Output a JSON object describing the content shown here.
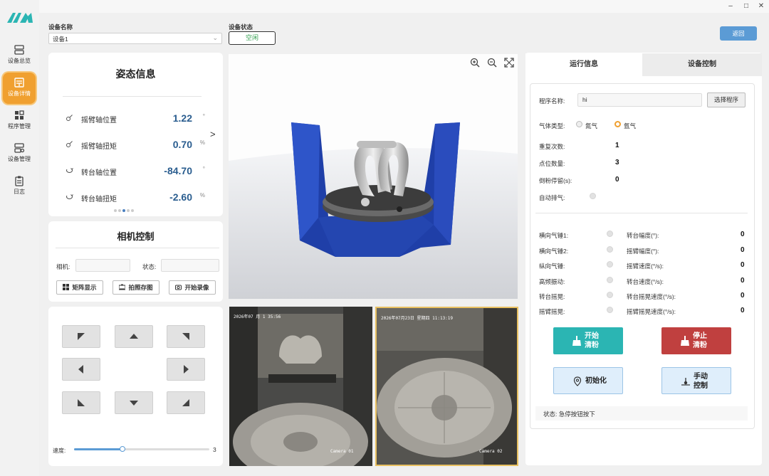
{
  "window": {
    "minimize": "–",
    "maximize": "□",
    "close": "✕"
  },
  "sidebar": {
    "items": [
      {
        "label": "设备总览",
        "icon": "server-icon"
      },
      {
        "label": "设备详情",
        "icon": "detail-icon",
        "active": true
      },
      {
        "label": "程序管理",
        "icon": "grid-icon"
      },
      {
        "label": "设备管理",
        "icon": "device-icon"
      },
      {
        "label": "日志",
        "icon": "clipboard-icon"
      }
    ]
  },
  "header": {
    "device_name_label": "设备名称",
    "device_name_value": "设备1",
    "device_status_label": "设备状态",
    "device_status_value": "空闲",
    "back_label": "返回"
  },
  "pose": {
    "title": "姿态信息",
    "rows": [
      {
        "name": "摇臂轴位置",
        "value": "1.22",
        "unit": "°"
      },
      {
        "name": "摇臂轴扭矩",
        "value": "0.70",
        "unit": "%"
      },
      {
        "name": "转台轴位置",
        "value": "-84.70",
        "unit": "°"
      },
      {
        "name": "转台轴扭矩",
        "value": "-2.60",
        "unit": "%"
      }
    ],
    "next": ">",
    "page_count": 5,
    "page_active": 2
  },
  "camera": {
    "title": "相机控制",
    "camera_label": "相机:",
    "status_label": "状态:",
    "matrix_btn": "矩阵显示",
    "photo_btn": "拍照存图",
    "record_btn": "开始录像"
  },
  "jog": {
    "speed_label": "速度:",
    "speed_value": "3",
    "speed_fraction": 0.36
  },
  "feeds": [
    {
      "timestamp": "2026年07 月 1 35:56",
      "name": "Camera 01"
    },
    {
      "timestamp": "2026年07月23日 星期四 11:13:19",
      "name": "Camera 02"
    }
  ],
  "tabs": {
    "run_info": "运行信息",
    "device_control": "设备控制"
  },
  "run": {
    "program_label": "程序名称:",
    "program_value": "hi",
    "select_program": "选择程序",
    "gas_label": "气体类型:",
    "gas_options": [
      "氮气",
      "氩气"
    ],
    "gas_selected": 1,
    "repeat_label": "重复次数:",
    "repeat_value": "1",
    "points_label": "点位数量:",
    "points_value": "3",
    "dump_label": "倒粉停留(s):",
    "dump_value": "0",
    "auto_exhaust_label": "自动排气:",
    "left_indicators": [
      "横向气锤1:",
      "横向气锤2:",
      "纵向气锤:",
      "高频振动:",
      "转台摇晃:",
      "摇臂摇晃:"
    ],
    "right_params": [
      {
        "label": "转台幅度(°):",
        "value": "0"
      },
      {
        "label": "摇臂幅度(°):",
        "value": "0"
      },
      {
        "label": "摇臂速度(°/s):",
        "value": "0"
      },
      {
        "label": "转台速度(°/s):",
        "value": "0"
      },
      {
        "label": "转台摇晃速度(°/s):",
        "value": "0"
      },
      {
        "label": "摇臂摇晃速度(°/s):",
        "value": "0"
      }
    ],
    "start_clean_1": "开始",
    "start_clean_2": "清粉",
    "stop_clean_1": "停止",
    "stop_clean_2": "清粉",
    "init_label": "初始化",
    "manual_1": "手动",
    "manual_2": "控制",
    "status_text": "状态: 急停按钮按下"
  },
  "colors": {
    "accent": "#f0a030",
    "teal": "#2bb5b3",
    "red": "#c0403f",
    "blue": "#2a5d8f",
    "status_green": "#2f9e4d"
  }
}
